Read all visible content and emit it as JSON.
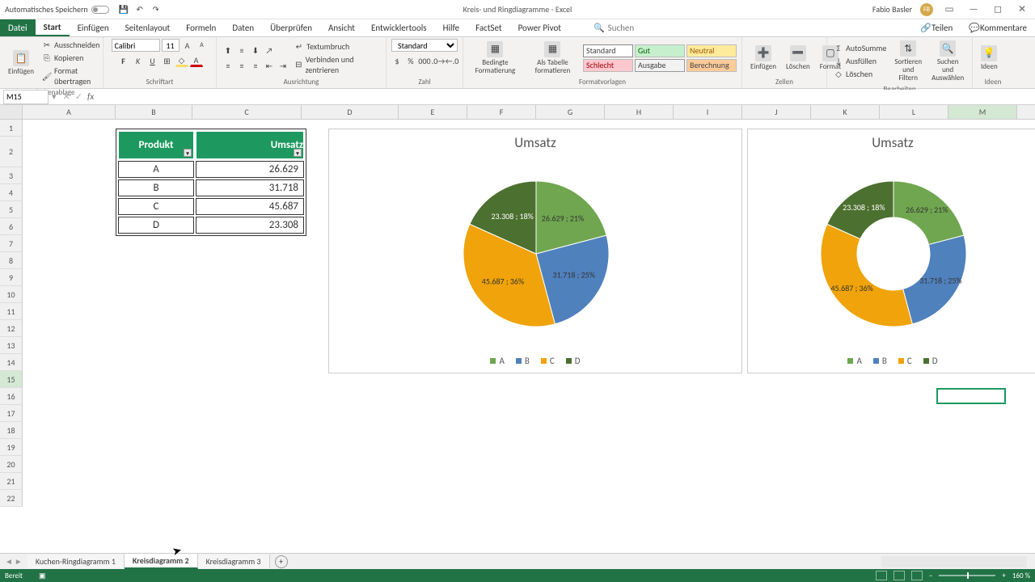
{
  "titlebar": {
    "autosave": "Automatisches Speichern",
    "title": "Kreis- und Ringdiagramme - Excel",
    "user": "Fabio Basler",
    "initials": "FB"
  },
  "tabs": {
    "file": "Datei",
    "items": [
      "Start",
      "Einfügen",
      "Seitenlayout",
      "Formeln",
      "Daten",
      "Überprüfen",
      "Ansicht",
      "Entwicklertools",
      "Hilfe",
      "FactSet",
      "Power Pivot"
    ],
    "search": "Suchen",
    "share": "Teilen",
    "comments": "Kommentare"
  },
  "ribbon": {
    "clipboard": {
      "paste": "Einfügen",
      "cut": "Ausschneiden",
      "copy": "Kopieren",
      "format_painter": "Format übertragen",
      "label": "Zwischenablage"
    },
    "font": {
      "name": "Calibri",
      "size": "11",
      "label": "Schriftart"
    },
    "alignment": {
      "wrap": "Textumbruch",
      "merge": "Verbinden und zentrieren",
      "label": "Ausrichtung"
    },
    "number": {
      "format": "Standard",
      "label": "Zahl"
    },
    "styles": {
      "cond": "Bedingte Formatierung",
      "table": "Als Tabelle formatieren",
      "std": "Standard",
      "bad": "Schlecht",
      "good": "Gut",
      "neutral": "Neutral",
      "out": "Ausgabe",
      "calc": "Berechnung",
      "label": "Formatvorlagen"
    },
    "cells": {
      "insert": "Einfügen",
      "delete": "Löschen",
      "format": "Format",
      "label": "Zellen"
    },
    "editing": {
      "sum": "AutoSumme",
      "fill": "Ausfüllen",
      "clear": "Löschen",
      "sort": "Sortieren und Filtern",
      "find": "Suchen und Auswählen",
      "label": "Bearbeiten"
    },
    "ideas": {
      "btn": "Ideen",
      "label": "Ideen"
    }
  },
  "namebox": "M15",
  "columns": [
    "A",
    "B",
    "C",
    "D",
    "E",
    "F",
    "G",
    "H",
    "I",
    "J",
    "K",
    "L",
    "M"
  ],
  "table": {
    "head_product": "Produkt",
    "head_value": "Umsatz",
    "rows": [
      {
        "p": "A",
        "v": "26.629"
      },
      {
        "p": "B",
        "v": "31.718"
      },
      {
        "p": "C",
        "v": "45.687"
      },
      {
        "p": "D",
        "v": "23.308"
      }
    ]
  },
  "chart_data": [
    {
      "type": "pie",
      "title": "Umsatz",
      "categories": [
        "A",
        "B",
        "C",
        "D"
      ],
      "values": [
        26629,
        31718,
        45687,
        23308
      ],
      "percentages": [
        21,
        25,
        36,
        18
      ],
      "labels": [
        "26.629 ; 21%",
        "31.718 ; 25%",
        "45.687 ; 36%",
        "23.308 ; 18%"
      ],
      "colors": [
        "#6fa64f",
        "#4f81bd",
        "#f0a30a",
        "#4c7030"
      ]
    },
    {
      "type": "donut",
      "title": "Umsatz",
      "categories": [
        "A",
        "B",
        "C",
        "D"
      ],
      "values": [
        26629,
        31718,
        45687,
        23308
      ],
      "percentages": [
        21,
        25,
        36,
        18
      ],
      "labels": [
        "26.629 ; 21%",
        "31.718 ; 25%",
        "45.687 ; 36%",
        "23.308 ; 18%"
      ],
      "colors": [
        "#6fa64f",
        "#4f81bd",
        "#f0a30a",
        "#4c7030"
      ]
    }
  ],
  "sheets": {
    "items": [
      "Kuchen-Ringdiagramm 1",
      "Kreisdiagramm 2",
      "Kreisdiagramm 3"
    ],
    "active": 1
  },
  "status": {
    "ready": "Bereit",
    "zoom": "160 %"
  }
}
